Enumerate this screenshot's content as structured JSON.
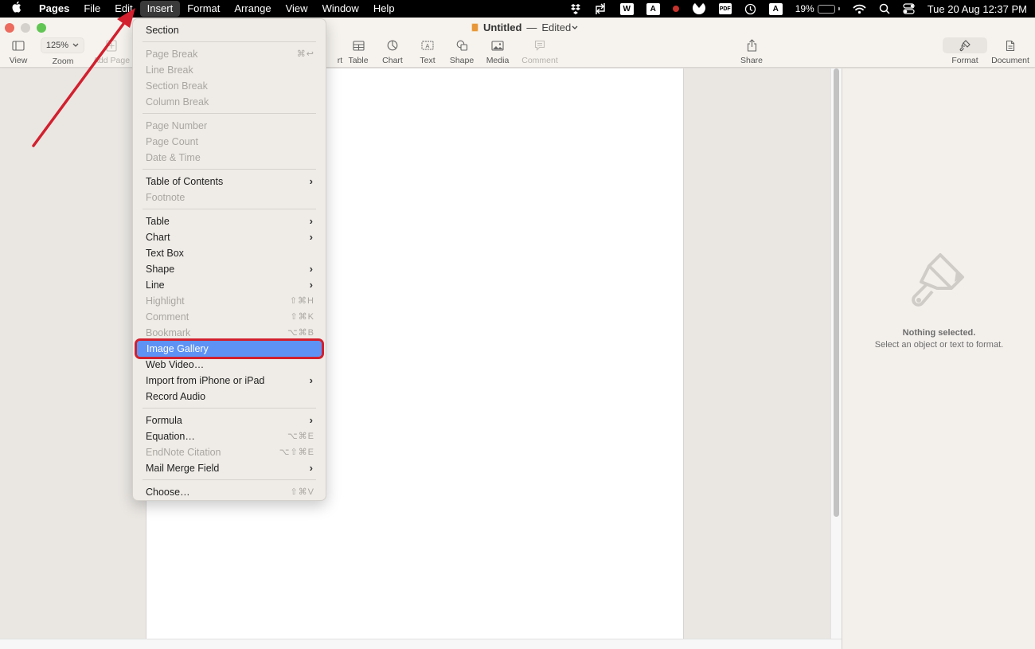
{
  "menubar": {
    "apple": "",
    "items": [
      "Pages",
      "File",
      "Edit",
      "Insert",
      "Format",
      "Arrange",
      "View",
      "Window",
      "Help"
    ],
    "active_item": "Insert",
    "status": {
      "dropbox": "dropbox-icon",
      "sync": "sync-icon",
      "wps_label": "W",
      "a_box_label": "A",
      "malwarebytes": "M",
      "pdf_label": "PDF",
      "input_label": "A",
      "battery_percent": "19%",
      "battery_level": 0.19,
      "datetime": "Tue 20 Aug  12:37 PM"
    }
  },
  "window": {
    "title": "Untitled",
    "title_sep": "—",
    "status": "Edited",
    "title_chevron": "⌄"
  },
  "toolbar": {
    "view": "View",
    "zoom_value": "125%",
    "zoom_label": "Zoom",
    "add_page": "Add Page",
    "insert_partial": "rt",
    "table": "Table",
    "chart": "Chart",
    "text": "Text",
    "shape": "Shape",
    "media": "Media",
    "comment": "Comment",
    "share": "Share",
    "format": "Format",
    "document": "Document"
  },
  "insert_menu": {
    "items": [
      {
        "label": "Section",
        "enabled": true
      },
      {
        "sep": true
      },
      {
        "label": "Page Break",
        "enabled": false,
        "shortcut": "⌘↩"
      },
      {
        "label": "Line Break",
        "enabled": false
      },
      {
        "label": "Section Break",
        "enabled": false
      },
      {
        "label": "Column Break",
        "enabled": false
      },
      {
        "sep": true
      },
      {
        "label": "Page Number",
        "enabled": false
      },
      {
        "label": "Page Count",
        "enabled": false
      },
      {
        "label": "Date & Time",
        "enabled": false
      },
      {
        "sep": true
      },
      {
        "label": "Table of Contents",
        "enabled": true,
        "submenu": true
      },
      {
        "label": "Footnote",
        "enabled": false
      },
      {
        "sep": true
      },
      {
        "label": "Table",
        "enabled": true,
        "submenu": true
      },
      {
        "label": "Chart",
        "enabled": true,
        "submenu": true
      },
      {
        "label": "Text Box",
        "enabled": true
      },
      {
        "label": "Shape",
        "enabled": true,
        "submenu": true
      },
      {
        "label": "Line",
        "enabled": true,
        "submenu": true
      },
      {
        "label": "Highlight",
        "enabled": false,
        "shortcut": "⇧⌘H"
      },
      {
        "label": "Comment",
        "enabled": false,
        "shortcut": "⇧⌘K"
      },
      {
        "label": "Bookmark",
        "enabled": false,
        "shortcut": "⌥⌘B"
      },
      {
        "label": "Image Gallery",
        "enabled": true,
        "highlighted": true
      },
      {
        "label": "Web Video…",
        "enabled": true
      },
      {
        "label": "Import from iPhone or iPad",
        "enabled": true,
        "submenu": true
      },
      {
        "label": "Record Audio",
        "enabled": true
      },
      {
        "sep": true
      },
      {
        "label": "Formula",
        "enabled": true,
        "submenu": true
      },
      {
        "label": "Equation…",
        "enabled": true,
        "shortcut": "⌥⌘E"
      },
      {
        "label": "EndNote Citation",
        "enabled": false,
        "shortcut": "⌥⇧⌘E"
      },
      {
        "label": "Mail Merge Field",
        "enabled": true,
        "submenu": true
      },
      {
        "sep": true
      },
      {
        "label": "Choose…",
        "enabled": true,
        "shortcut": "⇧⌘V"
      }
    ],
    "submenu_glyph": "›"
  },
  "inspector": {
    "empty_title": "Nothing selected.",
    "empty_subtitle": "Select an object or text to format.",
    "empty_icon": "paintbrush-icon"
  },
  "annotation": {
    "color": "#d2202e",
    "target": "Insert menu",
    "highlight_target": "Image Gallery"
  }
}
